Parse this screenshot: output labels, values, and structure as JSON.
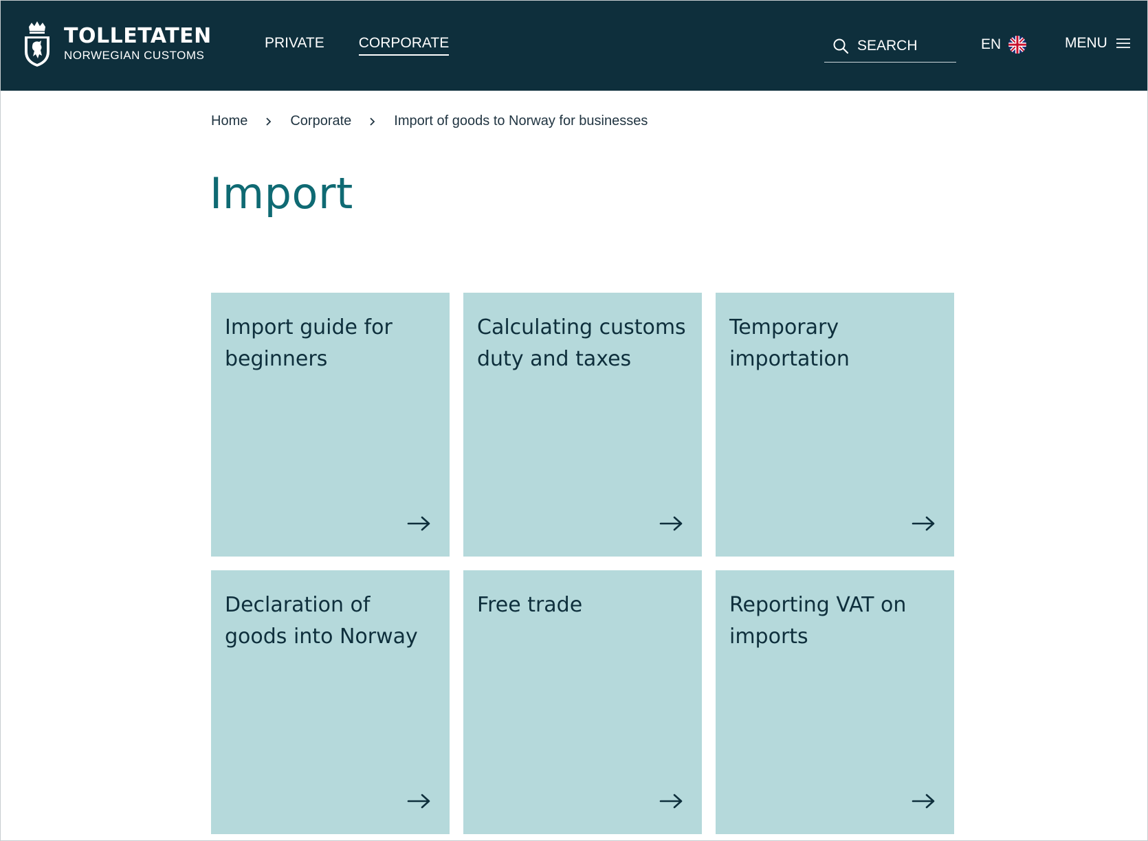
{
  "header": {
    "brand": "TOLLETATEN",
    "subbrand": "NORWEGIAN CUSTOMS",
    "nav": [
      {
        "label": "PRIVATE",
        "active": false
      },
      {
        "label": "CORPORATE",
        "active": true
      }
    ],
    "search_label": "SEARCH",
    "search_icon": "search-icon",
    "language": "EN",
    "language_icon": "uk-flag-icon",
    "menu_label": "MENU",
    "menu_icon": "hamburger-icon"
  },
  "breadcrumb": [
    "Home",
    "Corporate",
    "Import of goods to Norway for businesses"
  ],
  "page_title": "Import",
  "cards": [
    {
      "label": "Import guide for beginners"
    },
    {
      "label": "Calculating customs duty and taxes"
    },
    {
      "label": "Temporary importation"
    },
    {
      "label": "Declaration of goods into Norway"
    },
    {
      "label": "Free trade"
    },
    {
      "label": "Reporting VAT on imports"
    }
  ],
  "colors": {
    "header_bg": "#0e2f3c",
    "title": "#0f6a73",
    "card_bg": "#b5d9db",
    "text_dark": "#0e2f3c"
  }
}
